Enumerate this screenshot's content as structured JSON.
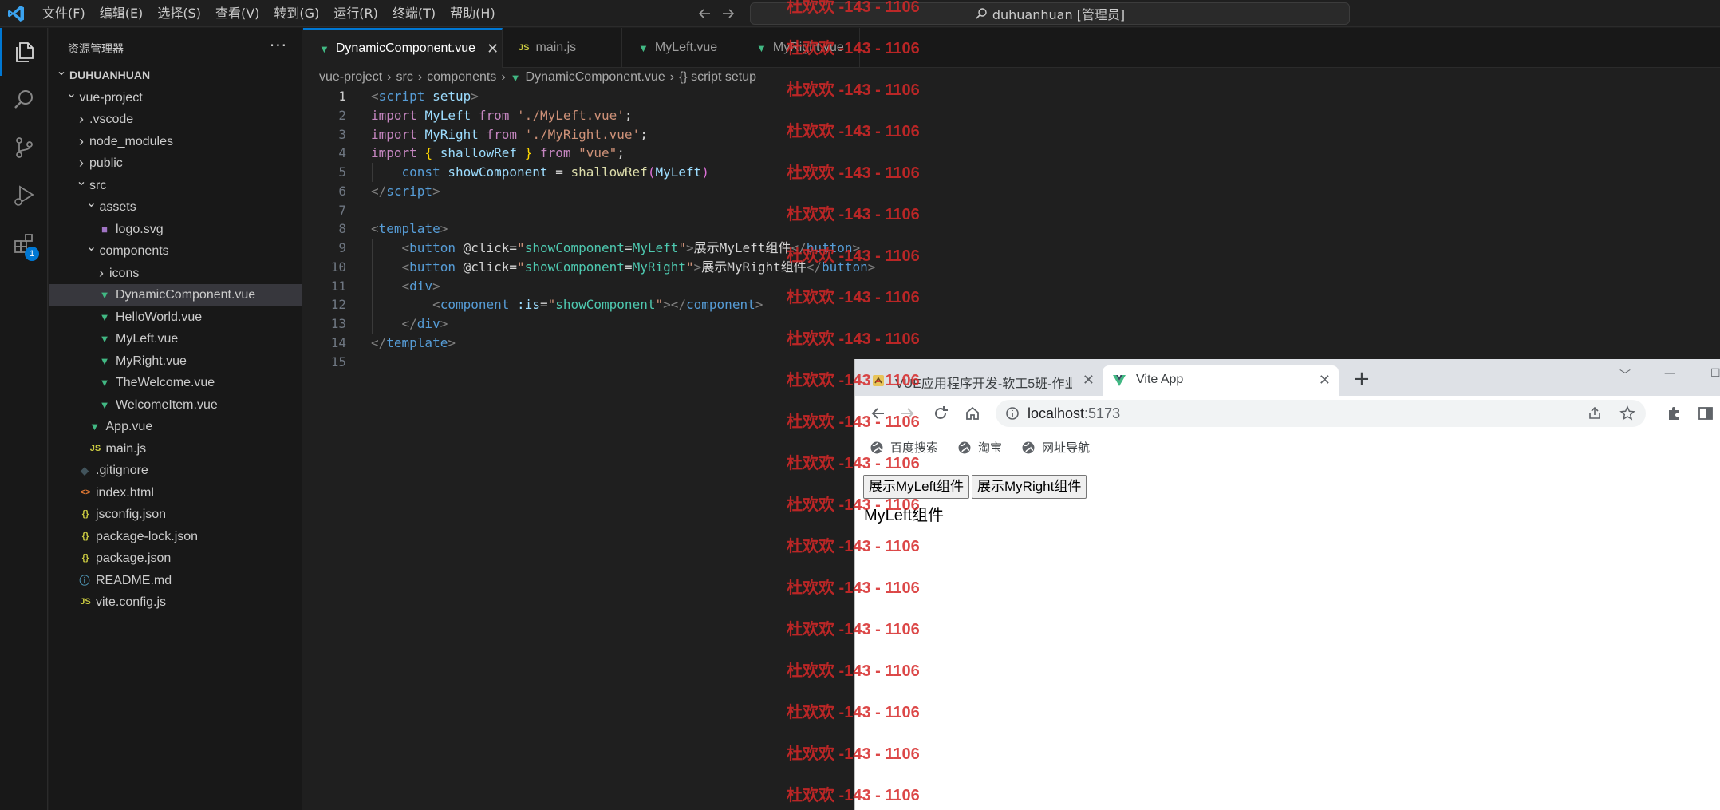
{
  "menubar": [
    "文件(F)",
    "编辑(E)",
    "选择(S)",
    "查看(V)",
    "转到(G)",
    "运行(R)",
    "终端(T)",
    "帮助(H)"
  ],
  "command_center": {
    "text": "duhuanhuan [管理员]"
  },
  "activity_bar": {
    "extensions_badge": "1"
  },
  "sidebar": {
    "title": "资源管理器",
    "more": "···",
    "tree": [
      {
        "label": "DUHUANHUAN",
        "type": "root",
        "depth": 0,
        "chevron": "down"
      },
      {
        "label": "vue-project",
        "type": "folder",
        "depth": 1,
        "chevron": "down"
      },
      {
        "label": ".vscode",
        "type": "folder",
        "depth": 2,
        "chevron": "right"
      },
      {
        "label": "node_modules",
        "type": "folder",
        "depth": 2,
        "chevron": "right"
      },
      {
        "label": "public",
        "type": "folder",
        "depth": 2,
        "chevron": "right"
      },
      {
        "label": "src",
        "type": "folder",
        "depth": 2,
        "chevron": "down"
      },
      {
        "label": "assets",
        "type": "folder",
        "depth": 3,
        "chevron": "down"
      },
      {
        "label": "logo.svg",
        "type": "svg",
        "depth": 4
      },
      {
        "label": "components",
        "type": "folder",
        "depth": 3,
        "chevron": "down"
      },
      {
        "label": "icons",
        "type": "folder",
        "depth": 4,
        "chevron": "right"
      },
      {
        "label": "DynamicComponent.vue",
        "type": "vue",
        "depth": 4,
        "selected": true
      },
      {
        "label": "HelloWorld.vue",
        "type": "vue",
        "depth": 4
      },
      {
        "label": "MyLeft.vue",
        "type": "vue",
        "depth": 4
      },
      {
        "label": "MyRight.vue",
        "type": "vue",
        "depth": 4
      },
      {
        "label": "TheWelcome.vue",
        "type": "vue",
        "depth": 4
      },
      {
        "label": "WelcomeItem.vue",
        "type": "vue",
        "depth": 4
      },
      {
        "label": "App.vue",
        "type": "vue",
        "depth": 3
      },
      {
        "label": "main.js",
        "type": "js",
        "depth": 3
      },
      {
        "label": ".gitignore",
        "type": "git",
        "depth": 2
      },
      {
        "label": "index.html",
        "type": "html",
        "depth": 2
      },
      {
        "label": "jsconfig.json",
        "type": "json",
        "depth": 2
      },
      {
        "label": "package-lock.json",
        "type": "json",
        "depth": 2
      },
      {
        "label": "package.json",
        "type": "json",
        "depth": 2
      },
      {
        "label": "README.md",
        "type": "info",
        "depth": 2
      },
      {
        "label": "vite.config.js",
        "type": "js",
        "depth": 2
      }
    ]
  },
  "editor_tabs": [
    {
      "label": "DynamicComponent.vue",
      "icon": "vue",
      "active": true,
      "close": "✕"
    },
    {
      "label": "main.js",
      "icon": "js"
    },
    {
      "label": "MyLeft.vue",
      "icon": "vue"
    },
    {
      "label": "MyRight.vue",
      "icon": "vue"
    }
  ],
  "breadcrumb": {
    "project": "vue-project",
    "src": "src",
    "components": "components",
    "file": "DynamicComponent.vue",
    "symbol": "{} script setup"
  },
  "code_lines": [
    [
      [
        "t-tag",
        "<"
      ],
      [
        "t-name",
        "script"
      ],
      [
        "t-plain",
        " "
      ],
      [
        "t-attr",
        "setup"
      ],
      [
        "t-tag",
        ">"
      ]
    ],
    [
      [
        "t-kw",
        "import"
      ],
      [
        "t-plain",
        " "
      ],
      [
        "t-var",
        "MyLeft"
      ],
      [
        "t-plain",
        " "
      ],
      [
        "t-kw",
        "from"
      ],
      [
        "t-plain",
        " "
      ],
      [
        "t-str",
        "'./MyLeft.vue'"
      ],
      [
        "t-plain",
        ";"
      ]
    ],
    [
      [
        "t-kw",
        "import"
      ],
      [
        "t-plain",
        " "
      ],
      [
        "t-var",
        "MyRight"
      ],
      [
        "t-plain",
        " "
      ],
      [
        "t-kw",
        "from"
      ],
      [
        "t-plain",
        " "
      ],
      [
        "t-str",
        "'./MyRight.vue'"
      ],
      [
        "t-plain",
        ";"
      ]
    ],
    [
      [
        "t-kw",
        "import"
      ],
      [
        "t-plain",
        " "
      ],
      [
        "t-brace",
        "{"
      ],
      [
        "t-plain",
        " "
      ],
      [
        "t-var",
        "shallowRef"
      ],
      [
        "t-plain",
        " "
      ],
      [
        "t-brace",
        "}"
      ],
      [
        "t-plain",
        " "
      ],
      [
        "t-kw",
        "from"
      ],
      [
        "t-plain",
        " "
      ],
      [
        "t-str",
        "\"vue\""
      ],
      [
        "t-plain",
        ";"
      ]
    ],
    [
      [
        "t-plain",
        "    "
      ],
      [
        "t-const",
        "const"
      ],
      [
        "t-plain",
        " "
      ],
      [
        "t-var",
        "showComponent"
      ],
      [
        "t-plain",
        " = "
      ],
      [
        "t-fn",
        "shallowRef"
      ],
      [
        "t-paren",
        "("
      ],
      [
        "t-var",
        "MyLeft"
      ],
      [
        "t-paren",
        ")"
      ]
    ],
    [
      [
        "t-tag",
        "</"
      ],
      [
        "t-name",
        "script"
      ],
      [
        "t-tag",
        ">"
      ]
    ],
    [],
    [
      [
        "t-tag",
        "<"
      ],
      [
        "t-name",
        "template"
      ],
      [
        "t-tag",
        ">"
      ]
    ],
    [
      [
        "t-plain",
        "    "
      ],
      [
        "t-tag",
        "<"
      ],
      [
        "t-name",
        "button"
      ],
      [
        "t-plain",
        " "
      ],
      [
        "t-evt",
        "@click"
      ],
      [
        "t-plain",
        "="
      ],
      [
        "t-str",
        "\""
      ],
      [
        "t-astr",
        "showComponent"
      ],
      [
        "t-plain",
        "="
      ],
      [
        "t-astr",
        "MyLeft"
      ],
      [
        "t-str",
        "\""
      ],
      [
        "t-tag",
        ">"
      ],
      [
        "t-plain",
        "展示MyLeft组件"
      ],
      [
        "t-tag",
        "</"
      ],
      [
        "t-name",
        "button"
      ],
      [
        "t-tag",
        ">"
      ]
    ],
    [
      [
        "t-plain",
        "    "
      ],
      [
        "t-tag",
        "<"
      ],
      [
        "t-name",
        "button"
      ],
      [
        "t-plain",
        " "
      ],
      [
        "t-evt",
        "@click"
      ],
      [
        "t-plain",
        "="
      ],
      [
        "t-str",
        "\""
      ],
      [
        "t-astr",
        "showComponent"
      ],
      [
        "t-plain",
        "="
      ],
      [
        "t-astr",
        "MyRight"
      ],
      [
        "t-str",
        "\""
      ],
      [
        "t-tag",
        ">"
      ],
      [
        "t-plain",
        "展示MyRight组件"
      ],
      [
        "t-tag",
        "</"
      ],
      [
        "t-name",
        "button"
      ],
      [
        "t-tag",
        ">"
      ]
    ],
    [
      [
        "t-plain",
        "    "
      ],
      [
        "t-tag",
        "<"
      ],
      [
        "t-name",
        "div"
      ],
      [
        "t-tag",
        ">"
      ]
    ],
    [
      [
        "t-plain",
        "        "
      ],
      [
        "t-tag",
        "<"
      ],
      [
        "t-name",
        "component"
      ],
      [
        "t-plain",
        " "
      ],
      [
        "t-attr",
        ":is"
      ],
      [
        "t-plain",
        "="
      ],
      [
        "t-str",
        "\""
      ],
      [
        "t-astr",
        "showComponent"
      ],
      [
        "t-str",
        "\""
      ],
      [
        "t-tag",
        "></"
      ],
      [
        "t-name",
        "component"
      ],
      [
        "t-tag",
        ">"
      ]
    ],
    [
      [
        "t-plain",
        "    "
      ],
      [
        "t-tag",
        "</"
      ],
      [
        "t-name",
        "div"
      ],
      [
        "t-tag",
        ">"
      ]
    ],
    [
      [
        "t-tag",
        "</"
      ],
      [
        "t-name",
        "template"
      ],
      [
        "t-tag",
        ">"
      ]
    ],
    []
  ],
  "current_line": 1,
  "browser": {
    "tabs": [
      {
        "label": "VUE应用程序开发-软工5班-作业",
        "favicon": "doc-icon",
        "active": false
      },
      {
        "label": "Vite App",
        "favicon": "vue-icon",
        "active": true
      }
    ],
    "new_tab": "+",
    "url_host": "localhost",
    "url_port": ":5173",
    "bookmarks": [
      "百度搜索",
      "淘宝",
      "网址导航"
    ],
    "page": {
      "button_left": "展示MyLeft组件",
      "button_right": "展示MyRight组件",
      "rendered": "MyLeft组件"
    }
  },
  "watermark": {
    "text": "杜欢欢 -143 - 1106",
    "color": "#d62828"
  }
}
